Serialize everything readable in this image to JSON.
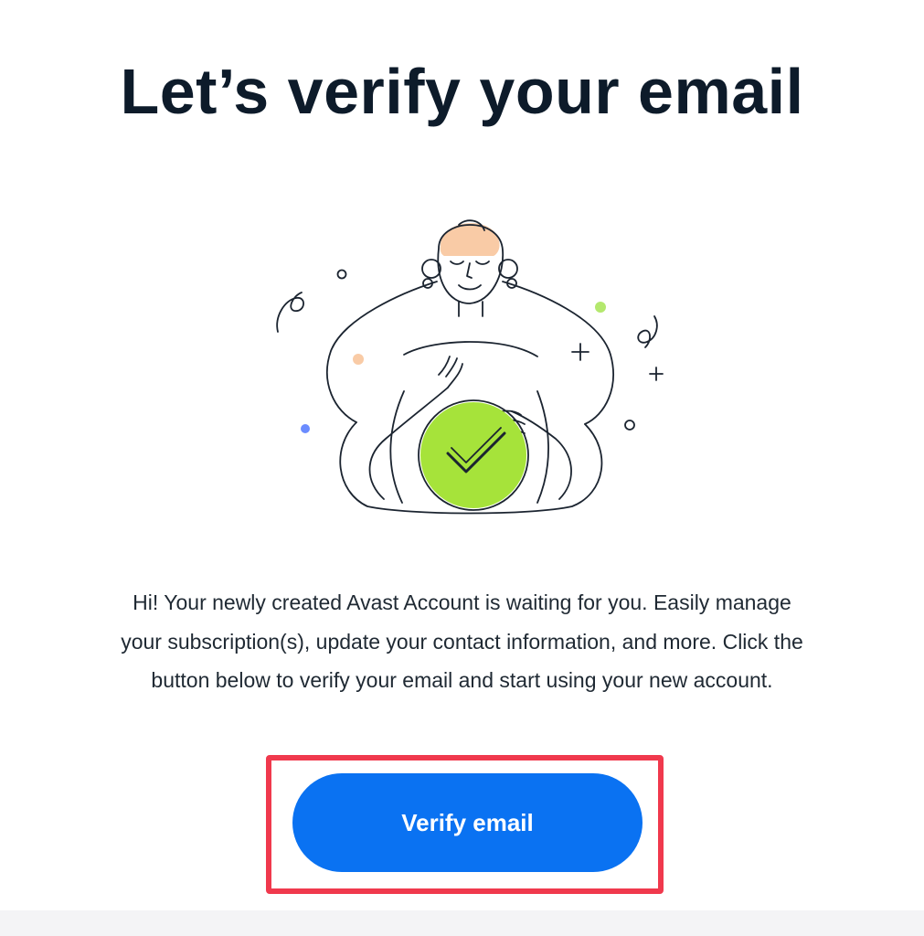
{
  "email": {
    "headline": "Let’s verify your email",
    "body_text": "Hi! Your newly created Avast Account is waiting for you. Easily manage your subscription(s), update your contact information, and more. Click the button below to verify your email and start using your new account.",
    "cta_label": "Verify email"
  },
  "colors": {
    "headline": "#0d1b2a",
    "body_text": "#1f2933",
    "button_bg": "#0a72f2",
    "button_text": "#ffffff",
    "highlight_border": "#f0394d",
    "check_circle": "#a6e33a",
    "confetti_peach": "#f9cba6",
    "confetti_blue": "#6b8cff",
    "confetti_green": "#b4e86e"
  },
  "illustration": {
    "subject": "woman-holding-checkmark-circle",
    "icons": [
      "checkmark-icon",
      "sparkle-icon",
      "confetti-squiggle-icon"
    ]
  }
}
